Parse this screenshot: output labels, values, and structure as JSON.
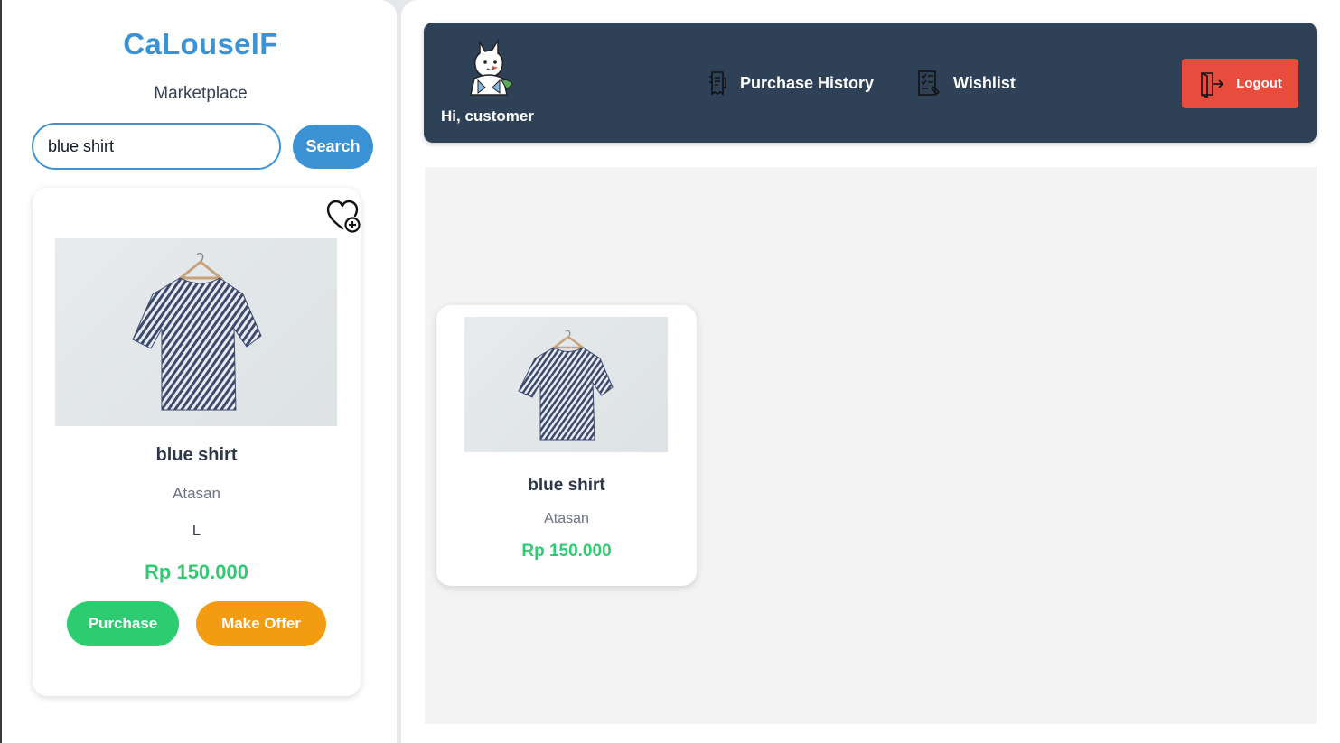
{
  "sidebar": {
    "brand_title": "CaLouselF",
    "brand_subtitle": "Marketplace",
    "search": {
      "value": "blue shirt",
      "placeholder": "Search",
      "button_label": "Search"
    },
    "selected_item": {
      "name": "blue shirt",
      "category": "Atasan",
      "size": "L",
      "price": "Rp 150.000",
      "purchase_label": "Purchase",
      "offer_label": "Make Offer",
      "wishlist_icon": "heart-plus-icon"
    }
  },
  "header": {
    "greeting": "Hi, customer",
    "avatar_icon": "mascot-avatar",
    "nav": [
      {
        "label": "Purchase History",
        "icon": "receipt-icon"
      },
      {
        "label": "Wishlist",
        "icon": "list-icon"
      }
    ],
    "logout_label": "Logout",
    "logout_icon": "door-exit-icon"
  },
  "products": [
    {
      "name": "blue shirt",
      "category": "Atasan",
      "price": "Rp 150.000"
    }
  ],
  "colors": {
    "brand": "#3b93d6",
    "header_bg": "#2f4156",
    "price": "#2ecc71",
    "purchase": "#2ecc71",
    "offer": "#f39c12",
    "logout": "#e74c3c"
  }
}
